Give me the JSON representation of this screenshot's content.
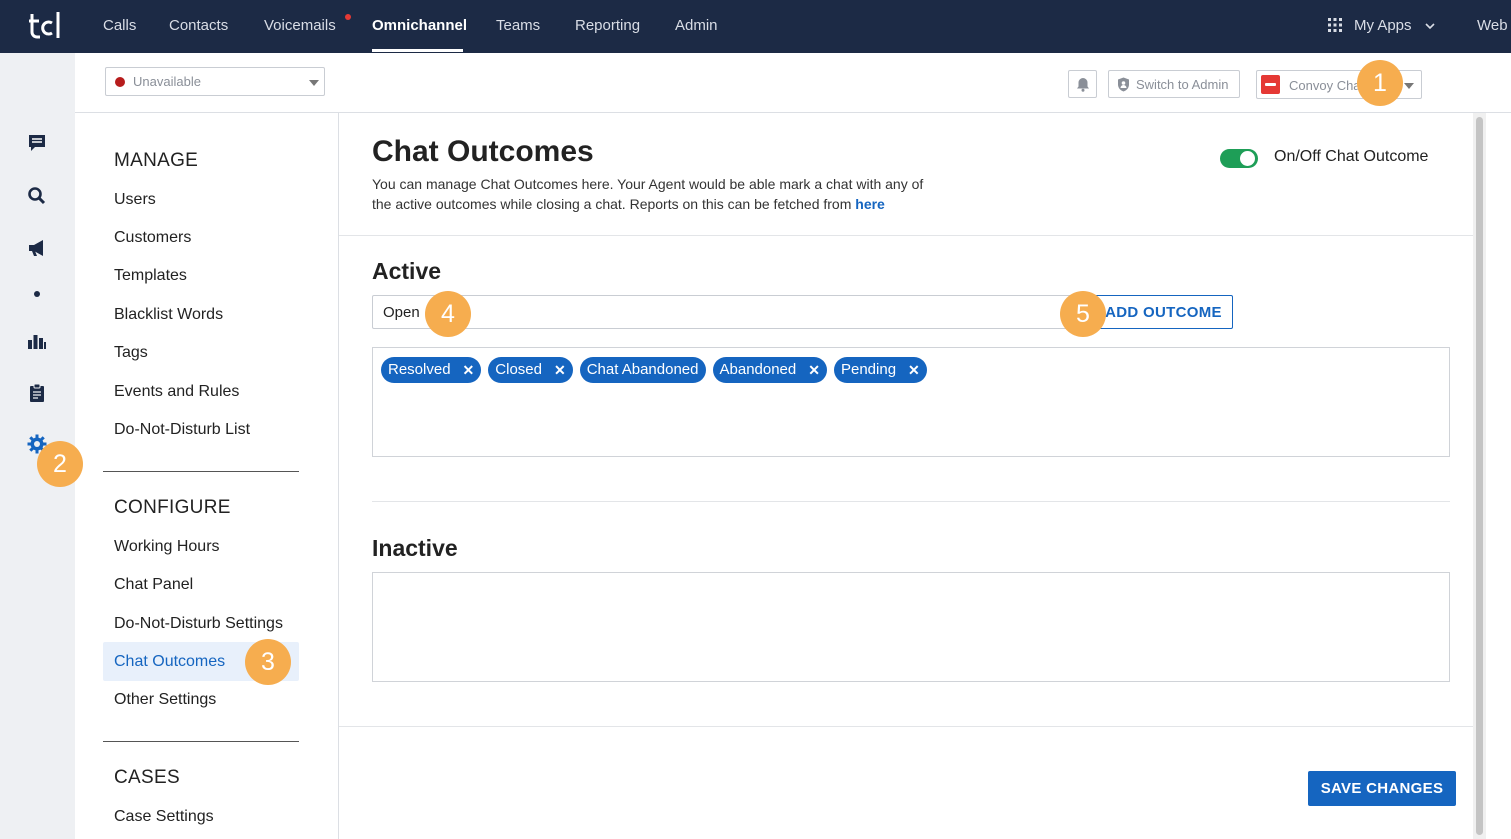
{
  "topnav": {
    "items": [
      "Calls",
      "Contacts",
      "Voicemails",
      "Omnichannel",
      "Teams",
      "Reporting",
      "Admin"
    ],
    "active": "Omnichannel",
    "apps_label": "My Apps",
    "web_label": "Web"
  },
  "header": {
    "status": "Unavailable",
    "switch_admin": "Switch to Admin",
    "workspace": "Convoy Chat"
  },
  "settings_nav": {
    "manage_title": "MANAGE",
    "manage_items": [
      "Users",
      "Customers",
      "Templates",
      "Blacklist Words",
      "Tags",
      "Events and Rules",
      "Do-Not-Disturb List"
    ],
    "configure_title": "CONFIGURE",
    "configure_items": [
      "Working Hours",
      "Chat Panel",
      "Do-Not-Disturb Settings",
      "Chat Outcomes",
      "Other Settings"
    ],
    "selected": "Chat Outcomes",
    "cases_title": "CASES",
    "cases_items": [
      "Case Settings"
    ]
  },
  "main": {
    "title": "Chat Outcomes",
    "description": "You can manage Chat Outcomes here. Your Agent would be able mark a chat with any of the active outcomes while closing a chat. Reports on this can be fetched from",
    "link_text": "here",
    "toggle_label": "On/Off Chat Outcome",
    "toggle_on": true,
    "active_title": "Active",
    "input_value": "Open",
    "add_button": "ADD OUTCOME",
    "active_tags": [
      "Resolved",
      "Closed",
      "Chat Abandoned",
      "Abandoned",
      "Pending"
    ],
    "inactive_title": "Inactive",
    "save_button": "SAVE CHANGES"
  },
  "markers": [
    "1",
    "2",
    "3",
    "4",
    "5"
  ],
  "colors": {
    "topbar": "#1c2a45",
    "accent": "#1565c0",
    "toggle": "#1e9e57",
    "marker": "#f6ad4f",
    "status_dot": "#b71c1c"
  },
  "icons": {
    "rail": [
      "chat-icon",
      "search-icon",
      "megaphone-icon",
      "dot-icon",
      "reports-icon",
      "clipboard-icon",
      "settings-gear-icon"
    ]
  }
}
